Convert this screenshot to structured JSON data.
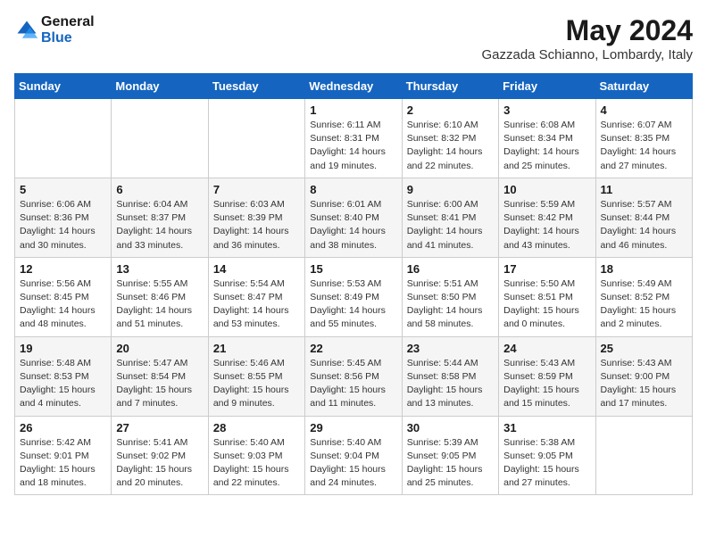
{
  "header": {
    "logo_line1": "General",
    "logo_line2": "Blue",
    "month_year": "May 2024",
    "location": "Gazzada Schianno, Lombardy, Italy"
  },
  "weekdays": [
    "Sunday",
    "Monday",
    "Tuesday",
    "Wednesday",
    "Thursday",
    "Friday",
    "Saturday"
  ],
  "weeks": [
    [
      {
        "day": "",
        "info": ""
      },
      {
        "day": "",
        "info": ""
      },
      {
        "day": "",
        "info": ""
      },
      {
        "day": "1",
        "info": "Sunrise: 6:11 AM\nSunset: 8:31 PM\nDaylight: 14 hours\nand 19 minutes."
      },
      {
        "day": "2",
        "info": "Sunrise: 6:10 AM\nSunset: 8:32 PM\nDaylight: 14 hours\nand 22 minutes."
      },
      {
        "day": "3",
        "info": "Sunrise: 6:08 AM\nSunset: 8:34 PM\nDaylight: 14 hours\nand 25 minutes."
      },
      {
        "day": "4",
        "info": "Sunrise: 6:07 AM\nSunset: 8:35 PM\nDaylight: 14 hours\nand 27 minutes."
      }
    ],
    [
      {
        "day": "5",
        "info": "Sunrise: 6:06 AM\nSunset: 8:36 PM\nDaylight: 14 hours\nand 30 minutes."
      },
      {
        "day": "6",
        "info": "Sunrise: 6:04 AM\nSunset: 8:37 PM\nDaylight: 14 hours\nand 33 minutes."
      },
      {
        "day": "7",
        "info": "Sunrise: 6:03 AM\nSunset: 8:39 PM\nDaylight: 14 hours\nand 36 minutes."
      },
      {
        "day": "8",
        "info": "Sunrise: 6:01 AM\nSunset: 8:40 PM\nDaylight: 14 hours\nand 38 minutes."
      },
      {
        "day": "9",
        "info": "Sunrise: 6:00 AM\nSunset: 8:41 PM\nDaylight: 14 hours\nand 41 minutes."
      },
      {
        "day": "10",
        "info": "Sunrise: 5:59 AM\nSunset: 8:42 PM\nDaylight: 14 hours\nand 43 minutes."
      },
      {
        "day": "11",
        "info": "Sunrise: 5:57 AM\nSunset: 8:44 PM\nDaylight: 14 hours\nand 46 minutes."
      }
    ],
    [
      {
        "day": "12",
        "info": "Sunrise: 5:56 AM\nSunset: 8:45 PM\nDaylight: 14 hours\nand 48 minutes."
      },
      {
        "day": "13",
        "info": "Sunrise: 5:55 AM\nSunset: 8:46 PM\nDaylight: 14 hours\nand 51 minutes."
      },
      {
        "day": "14",
        "info": "Sunrise: 5:54 AM\nSunset: 8:47 PM\nDaylight: 14 hours\nand 53 minutes."
      },
      {
        "day": "15",
        "info": "Sunrise: 5:53 AM\nSunset: 8:49 PM\nDaylight: 14 hours\nand 55 minutes."
      },
      {
        "day": "16",
        "info": "Sunrise: 5:51 AM\nSunset: 8:50 PM\nDaylight: 14 hours\nand 58 minutes."
      },
      {
        "day": "17",
        "info": "Sunrise: 5:50 AM\nSunset: 8:51 PM\nDaylight: 15 hours\nand 0 minutes."
      },
      {
        "day": "18",
        "info": "Sunrise: 5:49 AM\nSunset: 8:52 PM\nDaylight: 15 hours\nand 2 minutes."
      }
    ],
    [
      {
        "day": "19",
        "info": "Sunrise: 5:48 AM\nSunset: 8:53 PM\nDaylight: 15 hours\nand 4 minutes."
      },
      {
        "day": "20",
        "info": "Sunrise: 5:47 AM\nSunset: 8:54 PM\nDaylight: 15 hours\nand 7 minutes."
      },
      {
        "day": "21",
        "info": "Sunrise: 5:46 AM\nSunset: 8:55 PM\nDaylight: 15 hours\nand 9 minutes."
      },
      {
        "day": "22",
        "info": "Sunrise: 5:45 AM\nSunset: 8:56 PM\nDaylight: 15 hours\nand 11 minutes."
      },
      {
        "day": "23",
        "info": "Sunrise: 5:44 AM\nSunset: 8:58 PM\nDaylight: 15 hours\nand 13 minutes."
      },
      {
        "day": "24",
        "info": "Sunrise: 5:43 AM\nSunset: 8:59 PM\nDaylight: 15 hours\nand 15 minutes."
      },
      {
        "day": "25",
        "info": "Sunrise: 5:43 AM\nSunset: 9:00 PM\nDaylight: 15 hours\nand 17 minutes."
      }
    ],
    [
      {
        "day": "26",
        "info": "Sunrise: 5:42 AM\nSunset: 9:01 PM\nDaylight: 15 hours\nand 18 minutes."
      },
      {
        "day": "27",
        "info": "Sunrise: 5:41 AM\nSunset: 9:02 PM\nDaylight: 15 hours\nand 20 minutes."
      },
      {
        "day": "28",
        "info": "Sunrise: 5:40 AM\nSunset: 9:03 PM\nDaylight: 15 hours\nand 22 minutes."
      },
      {
        "day": "29",
        "info": "Sunrise: 5:40 AM\nSunset: 9:04 PM\nDaylight: 15 hours\nand 24 minutes."
      },
      {
        "day": "30",
        "info": "Sunrise: 5:39 AM\nSunset: 9:05 PM\nDaylight: 15 hours\nand 25 minutes."
      },
      {
        "day": "31",
        "info": "Sunrise: 5:38 AM\nSunset: 9:05 PM\nDaylight: 15 hours\nand 27 minutes."
      },
      {
        "day": "",
        "info": ""
      }
    ]
  ]
}
